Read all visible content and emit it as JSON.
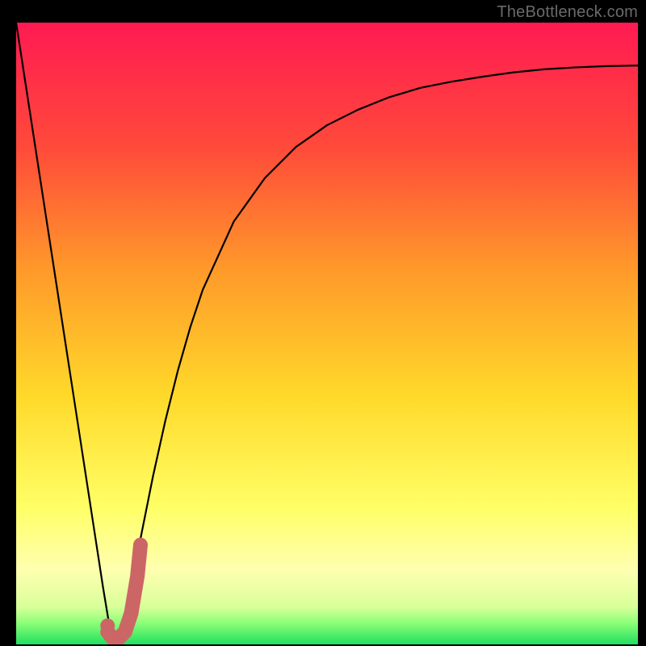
{
  "watermark": "TheBottleneck.com",
  "chart_data": {
    "type": "line",
    "title": "",
    "xlabel": "",
    "ylabel": "",
    "xlim": [
      0,
      100
    ],
    "ylim": [
      0,
      100
    ],
    "grid": false,
    "series": [
      {
        "name": "bottleneck-curve",
        "x": [
          0,
          2,
          4,
          6,
          8,
          10,
          12,
          14,
          15,
          16,
          18,
          20,
          22,
          24,
          26,
          28,
          30,
          35,
          40,
          45,
          50,
          55,
          60,
          65,
          70,
          75,
          80,
          85,
          90,
          95,
          100
        ],
        "y": [
          100,
          87,
          74,
          61,
          48,
          35,
          22,
          9,
          3,
          0,
          6,
          17,
          27,
          36,
          44,
          51,
          57,
          68,
          75,
          80,
          83.5,
          86,
          88,
          89.5,
          90.5,
          91.3,
          92,
          92.5,
          92.8,
          93.0,
          93.1
        ]
      }
    ],
    "marker": {
      "x": 14.7,
      "y": 3.0
    },
    "thick_segment": {
      "x": [
        14.7,
        15.5,
        16.5,
        17.5,
        18.5,
        19.5,
        20.0
      ],
      "y": [
        2.0,
        1.0,
        1.0,
        2.0,
        5.0,
        11.0,
        16.0
      ]
    },
    "gradient_stops": [
      {
        "offset": 0.0,
        "color": "#ff1a52"
      },
      {
        "offset": 0.2,
        "color": "#ff4a3a"
      },
      {
        "offset": 0.4,
        "color": "#ff9a2a"
      },
      {
        "offset": 0.6,
        "color": "#ffd92a"
      },
      {
        "offset": 0.78,
        "color": "#ffff66"
      },
      {
        "offset": 0.88,
        "color": "#ffffb0"
      },
      {
        "offset": 0.94,
        "color": "#d8ff99"
      },
      {
        "offset": 0.965,
        "color": "#8eff78"
      },
      {
        "offset": 1.0,
        "color": "#20e060"
      }
    ],
    "highlight_color": "#cc6666"
  }
}
